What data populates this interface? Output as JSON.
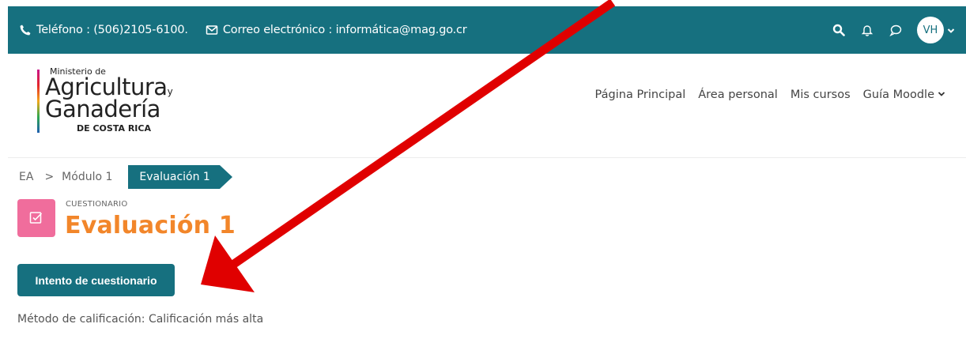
{
  "topbar": {
    "phone": "Teléfono : (506)2105-6100.",
    "email": "Correo electrónico : informática@mag.go.cr",
    "avatar_initials": "VH",
    "icons": [
      "phone-icon",
      "mail-icon",
      "search-icon",
      "bell-icon",
      "chat-icon",
      "chevron-down-icon"
    ]
  },
  "logo": {
    "line1": "Ministerio de",
    "line2": "Agricultura",
    "line2_suffix": "y",
    "line3": "Ganadería",
    "line4": "DE COSTA RICA"
  },
  "nav": {
    "items": [
      "Página Principal",
      "Área personal",
      "Mis cursos",
      "Guía Moodle"
    ]
  },
  "breadcrumb": {
    "items": [
      "EA",
      "Módulo 1",
      "Evaluación 1"
    ],
    "separator": ">"
  },
  "activity": {
    "type_label": "CUESTIONARIO",
    "title": "Evaluación 1",
    "attempt_button": "Intento de cuestionario",
    "grading_method": "Método de calificación: Calificación más alta"
  },
  "colors": {
    "primary": "#16707f",
    "title": "#f2862a",
    "quiz_icon_bg": "#f06d9c",
    "annotation_arrow": "#e00000"
  }
}
